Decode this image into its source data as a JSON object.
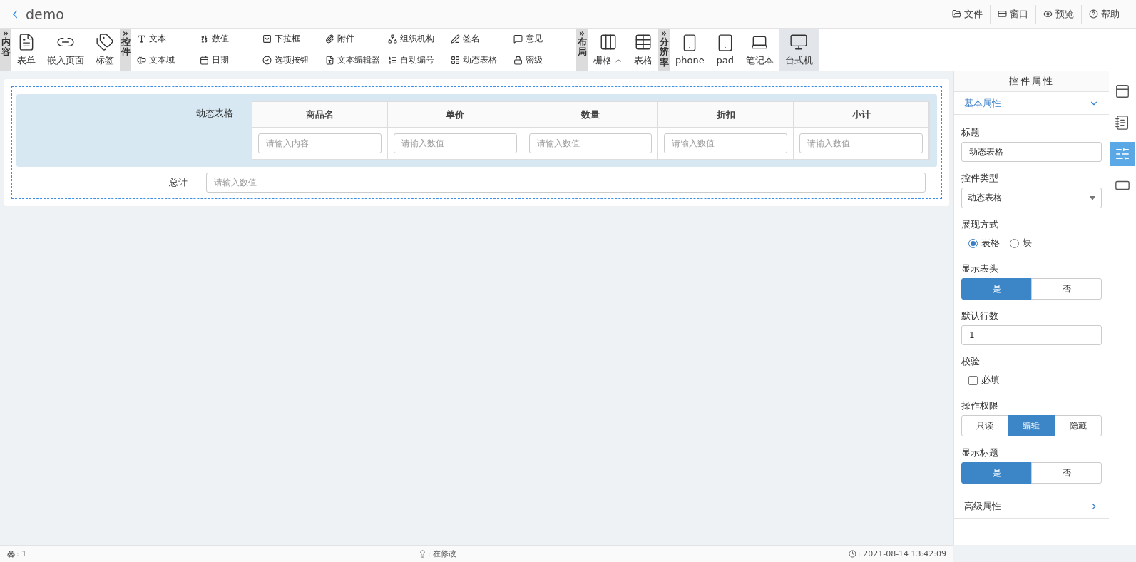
{
  "header": {
    "title": "demo",
    "menu": [
      {
        "label": "文件"
      },
      {
        "label": "窗口"
      },
      {
        "label": "预览"
      },
      {
        "label": "帮助"
      }
    ]
  },
  "toolbar": [
    {
      "title": "内容",
      "kind": "large",
      "items": [
        {
          "label": "表单",
          "selected": false
        },
        {
          "label": "嵌入页面",
          "selected": false
        },
        {
          "label": "标签",
          "selected": false
        }
      ]
    },
    {
      "title": "控件",
      "kind": "small",
      "items": [
        {
          "label": "文本"
        },
        {
          "label": "文本域"
        },
        {
          "label": "数值"
        },
        {
          "label": "日期"
        },
        {
          "label": "下拉框"
        },
        {
          "label": "选项按钮"
        },
        {
          "label": "附件"
        },
        {
          "label": "文本编辑器"
        },
        {
          "label": "组织机构"
        },
        {
          "label": "自动编号"
        },
        {
          "label": "签名"
        },
        {
          "label": "动态表格"
        },
        {
          "label": "意见"
        },
        {
          "label": "密级"
        }
      ]
    },
    {
      "title": "布局",
      "kind": "large",
      "items": [
        {
          "label": "栅格",
          "selected": false
        },
        {
          "label": "表格",
          "selected": false
        }
      ]
    },
    {
      "title": "分辨率",
      "kind": "large",
      "items": [
        {
          "label": "phone",
          "selected": false
        },
        {
          "label": "pad",
          "selected": false
        },
        {
          "label": "笔记本",
          "selected": false
        },
        {
          "label": "台式机",
          "selected": true
        }
      ]
    }
  ],
  "form": {
    "table_label": "动态表格",
    "columns": [
      "商品名",
      "单价",
      "数量",
      "折扣",
      "小计"
    ],
    "row_placeholders": [
      "请输入内容",
      "请输入数值",
      "请输入数值",
      "请输入数值",
      "请输入数值"
    ],
    "total_label": "总计",
    "total_placeholder": "请输入数值"
  },
  "panel": {
    "title": "控件属性",
    "basic": {
      "label": "基本属性",
      "expanded": true
    },
    "fields": [
      {
        "kind": "text",
        "label": "标题",
        "value": "动态表格"
      },
      {
        "kind": "select",
        "label": "控件类型",
        "value": "动态表格"
      },
      {
        "kind": "radio",
        "label": "展现方式",
        "options": [
          {
            "label": "表格",
            "selected": true
          },
          {
            "label": "块",
            "selected": false
          }
        ]
      },
      {
        "kind": "segmented",
        "label": "显示表头",
        "options": [
          {
            "label": "是",
            "selected": true
          },
          {
            "label": "否",
            "selected": false
          }
        ]
      },
      {
        "kind": "text",
        "label": "默认行数",
        "value": "1"
      },
      {
        "kind": "checkbox",
        "label": "校验",
        "option": "必填",
        "checked": false
      },
      {
        "kind": "segmented",
        "label": "操作权限",
        "options": [
          {
            "label": "只读",
            "selected": false
          },
          {
            "label": "编辑",
            "selected": true
          },
          {
            "label": "隐藏",
            "selected": false
          }
        ]
      },
      {
        "kind": "segmented",
        "label": "显示标题",
        "options": [
          {
            "label": "是",
            "selected": true
          },
          {
            "label": "否",
            "selected": false
          }
        ]
      }
    ],
    "advanced": {
      "label": "高级属性",
      "expanded": false
    }
  },
  "side_tabs": [
    {
      "selected": false
    },
    {
      "selected": false
    },
    {
      "selected": true
    },
    {
      "selected": false
    }
  ],
  "status_bar": {
    "count": ": 1",
    "state": ": 在修改",
    "time": ": 2021-08-14 13:42:09"
  }
}
